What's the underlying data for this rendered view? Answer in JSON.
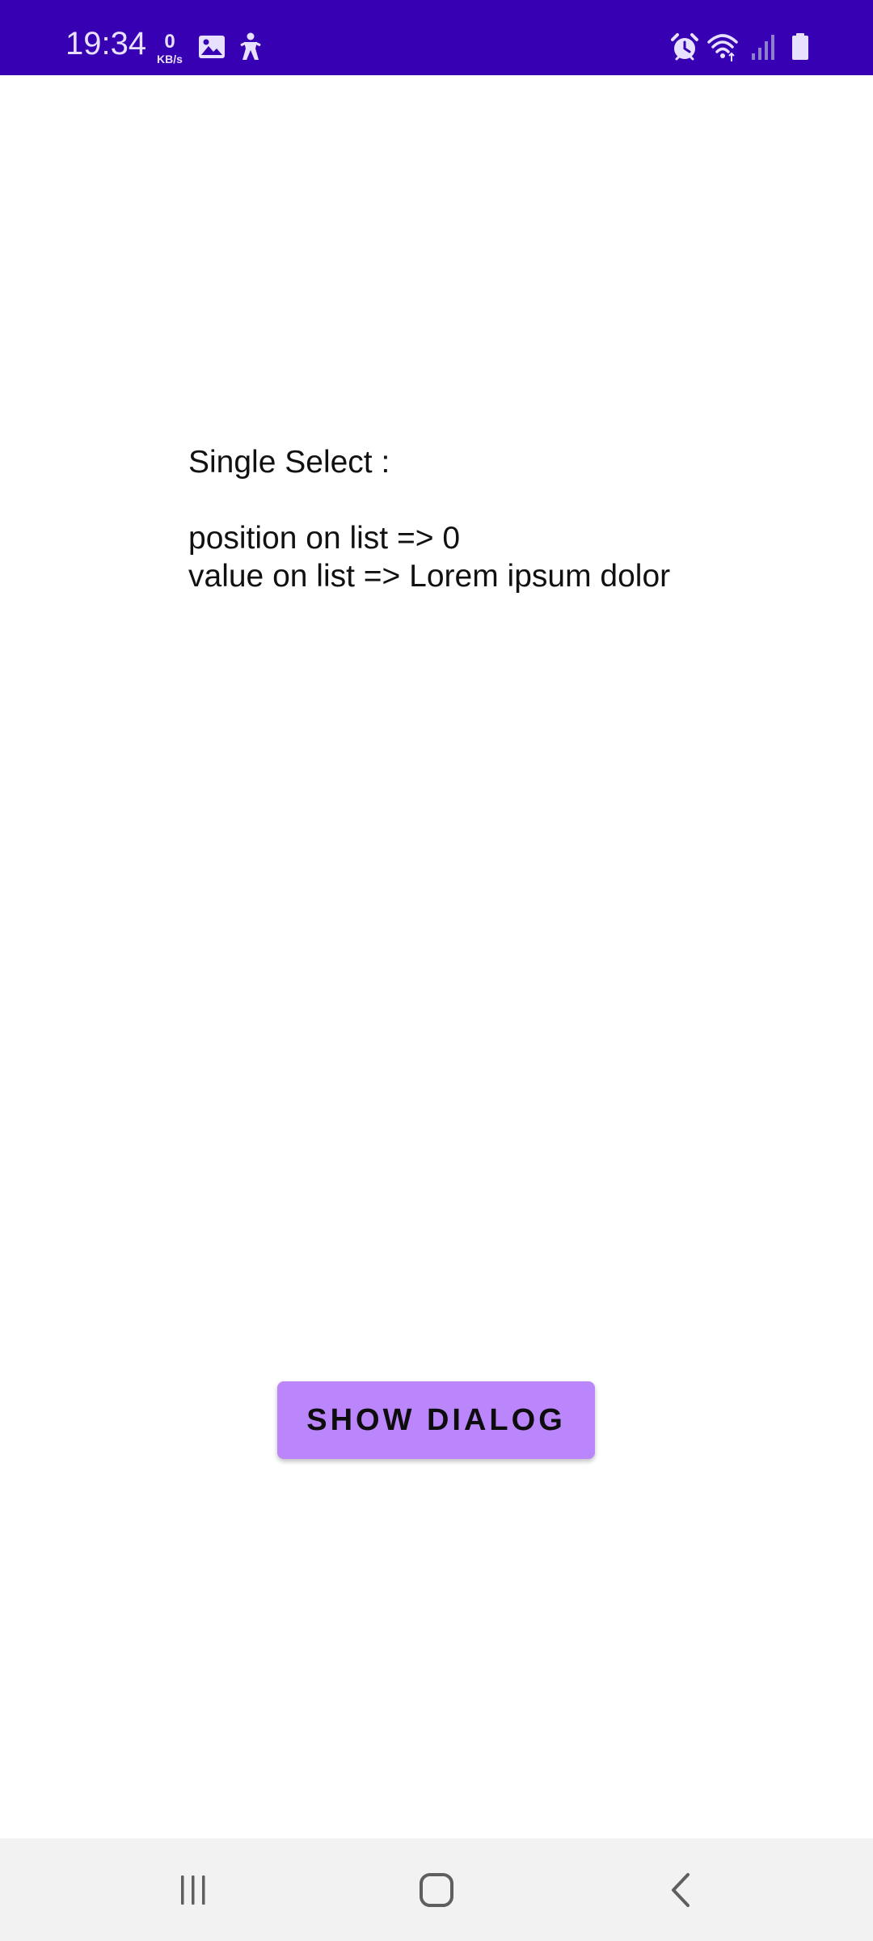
{
  "status_bar": {
    "time": "19:34",
    "data_rate_value": "0",
    "data_rate_unit": "KB/s",
    "left_icons": [
      "gallery-icon",
      "accessibility-icon"
    ],
    "right_icons": [
      "alarm-icon",
      "wifi-icon",
      "signal-icon",
      "battery-icon"
    ],
    "background": "#3700b3"
  },
  "content": {
    "heading": "Single Select :",
    "position_line": "position on list => 0",
    "value_line": "value on list => Lorem ipsum dolor"
  },
  "button": {
    "label": "SHOW DIALOG",
    "color": "#bb86fc"
  },
  "nav_bar": {
    "items": [
      "recents-icon",
      "home-icon",
      "back-icon"
    ]
  }
}
